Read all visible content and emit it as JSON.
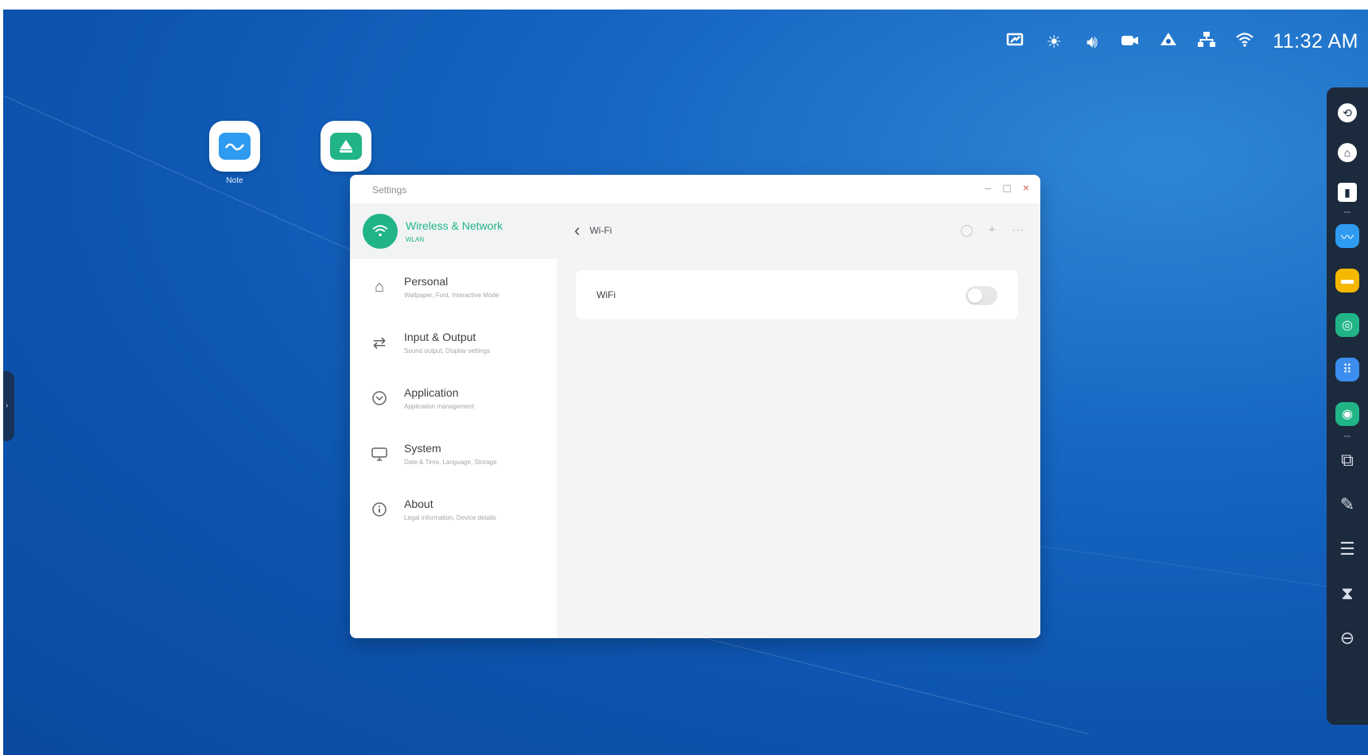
{
  "statusbar": {
    "icons": [
      "screen-share-icon",
      "brightness-icon",
      "volume-icon",
      "camera-icon",
      "eye-care-icon",
      "network-icon",
      "wifi-icon"
    ],
    "time": "11:32 AM"
  },
  "desktop": {
    "apps": [
      {
        "label": "Note",
        "icon": "whiteboard-app-icon",
        "color": "#2f9bf0"
      },
      {
        "label": "",
        "icon": "cast-app-icon",
        "color": "#20b486"
      }
    ]
  },
  "window": {
    "title": "Settings",
    "controls": {
      "minimize": "–",
      "maximize": "◻",
      "close": "×"
    }
  },
  "sidebar": {
    "items": [
      {
        "title": "Wireless & Network",
        "subtitle": "WLAN",
        "icon": "wifi-icon",
        "active": true
      },
      {
        "title": "Personal",
        "subtitle": "Wallpaper, Font, Interactive Mode",
        "icon": "home-icon",
        "active": false
      },
      {
        "title": "Input & Output",
        "subtitle": "Sound output, Display settings",
        "icon": "swap-icon",
        "active": false
      },
      {
        "title": "Application",
        "subtitle": "Application management",
        "icon": "app-download-icon",
        "active": false
      },
      {
        "title": "System",
        "subtitle": "Date & Time, Language, Storage",
        "icon": "monitor-icon",
        "active": false
      },
      {
        "title": "About",
        "subtitle": "Legal information, Device details",
        "icon": "info-icon",
        "active": false
      }
    ]
  },
  "content": {
    "title": "Wi-Fi",
    "actions": [
      "refresh-icon",
      "add-icon",
      "more-icon"
    ],
    "wifi_row": {
      "label": "WiFi",
      "enabled": false
    }
  },
  "dock": {
    "items": [
      "back-icon",
      "home-icon",
      "recent-apps-icon",
      "whiteboard-app-icon",
      "folder-app-icon",
      "browser-app-icon",
      "apps-grid-icon",
      "settings-app-icon",
      "screen-share-icon",
      "annotate-icon",
      "split-screen-icon",
      "timer-icon",
      "minus-circle-icon"
    ]
  },
  "colors": {
    "accent": "#20b486",
    "desktop": "#1666c2",
    "dock": "#1c2a3d"
  }
}
